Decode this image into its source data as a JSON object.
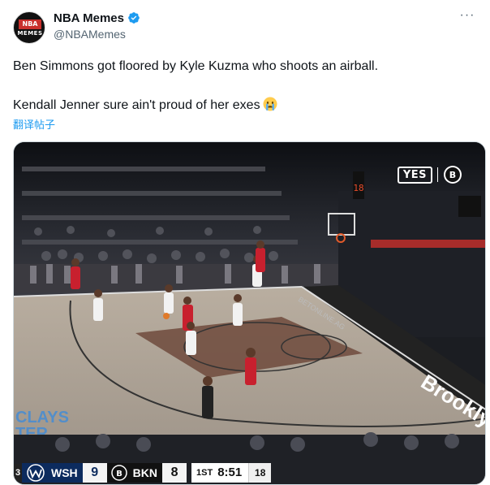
{
  "tweet": {
    "display_name": "NBA Memes",
    "handle": "@NBAMemes",
    "avatar_text_top": "NBA",
    "avatar_text_bottom": "MEMES",
    "more_icon": "more-horizontal-icon",
    "verified_icon": "verified-badge-icon",
    "text_line_1": "Ben Simmons got floored by Kyle Kuzma who shoots an airball.",
    "text_line_2": "Kendall Jenner sure ain't proud of her exes",
    "emoji": "crying-face-emoji",
    "translate_label": "翻译帖子"
  },
  "video": {
    "network_badge": "YES",
    "scoreboard": {
      "left_cap": "3",
      "away_team": "WSH",
      "away_score": "9",
      "home_team": "BKN",
      "home_score": "8",
      "period": "1ST",
      "clock": "8:51",
      "shot_clock": "18"
    },
    "shot_clock_display": "18",
    "court_text_right": "Brooklyn",
    "court_text_left": "CLAYS\nTER",
    "sideline_text": "BETONLINE.AG"
  },
  "colors": {
    "verified_blue": "#1d9bf0",
    "link_blue": "#1d9bf0",
    "wizards_navy": "#0c2b5e",
    "wizards_red": "#c8102e"
  }
}
